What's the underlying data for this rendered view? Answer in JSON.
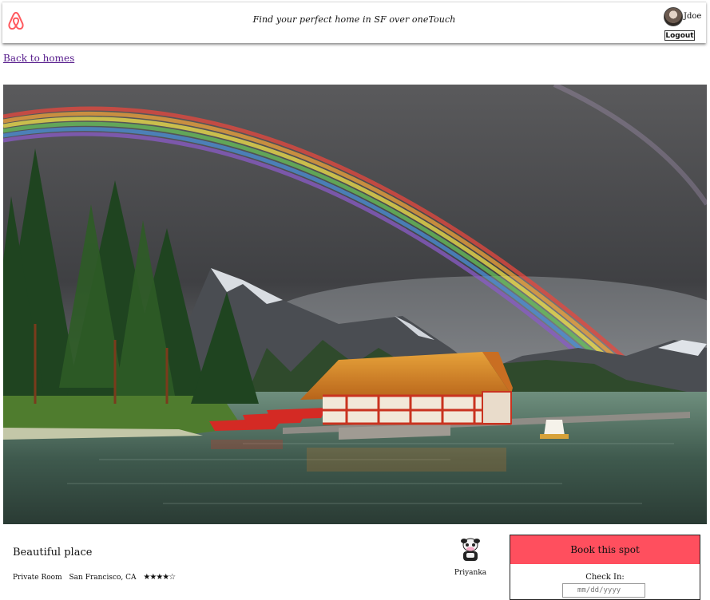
{
  "header": {
    "tagline": "Find your perfect home in SF over oneTouch",
    "username": "Jdoe",
    "logout_label": "Logout",
    "brand_color": "#ff5a5f"
  },
  "nav": {
    "back_link": "Back to homes"
  },
  "listing": {
    "title": "Beautiful place",
    "room_type": "Private Room",
    "location": "San Francisco, CA",
    "stars": "★★★★☆",
    "rating": 4,
    "rating_max": 5,
    "host_name": "Priyanka"
  },
  "booking": {
    "button_label": "Book this spot",
    "checkin_label": "Check In:",
    "checkin_placeholder": "mm/dd/yyyy",
    "accent_color": "#ff4f5e"
  }
}
